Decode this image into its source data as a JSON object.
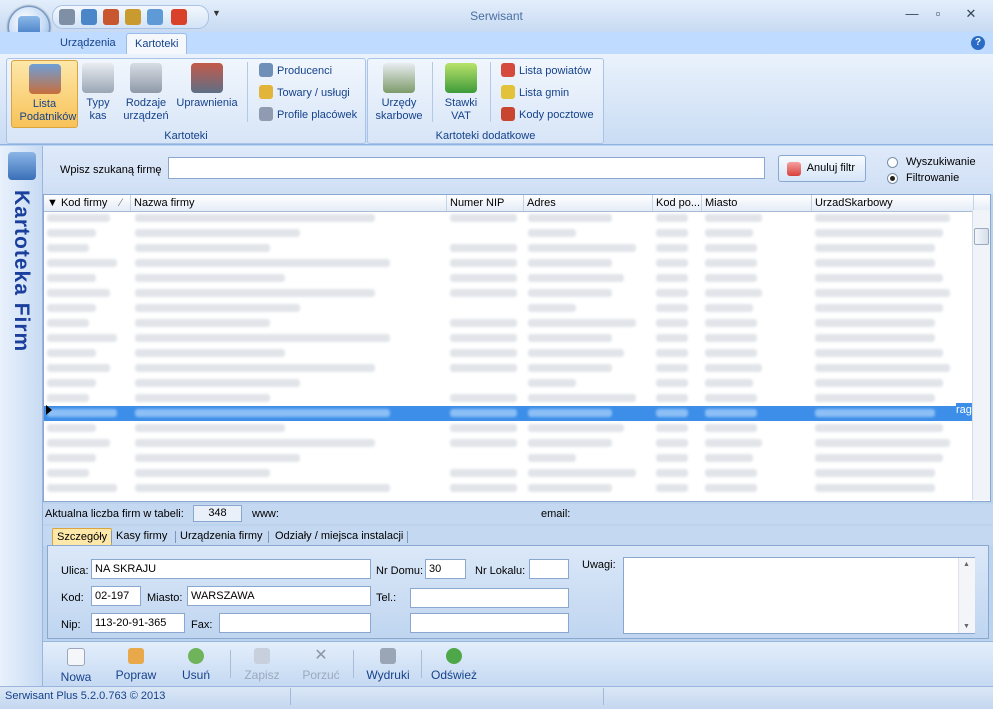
{
  "window": {
    "title": "Serwisant"
  },
  "ribbon": {
    "tabs": [
      "Urządzenia",
      "Kartoteki"
    ],
    "groups": {
      "kartoteki": "Kartoteki",
      "dodatkowe": "Kartoteki dodatkowe"
    },
    "buttons": {
      "lista": "Lista Podatników",
      "typy": "Typy kas",
      "rodzaje": "Rodzaje urządzeń",
      "uprawnienia": "Uprawnienia",
      "producenci": "Producenci",
      "towary": "Towary / usługi",
      "profile": "Profile placówek",
      "urzedy": "Urzędy skarbowe",
      "stawki": "Stawki VAT",
      "powiaty": "Lista powiatów",
      "gminy": "Lista gmin",
      "kody": "Kody pocztowe"
    }
  },
  "sidebar": {
    "title": "Kartoteka Firm"
  },
  "search": {
    "label": "Wpisz szukaną firmę",
    "value": "",
    "cancel_label": "Anuluj filtr",
    "mode_search": "Wyszukiwanie",
    "mode_filter": "Filtrowanie",
    "selected_mode": "Filtrowanie"
  },
  "grid": {
    "columns": [
      "Kod firmy",
      "Nazwa firmy",
      "Numer NIP",
      "Adres",
      "Kod po...",
      "Miasto",
      "UrzadSkarbowy"
    ],
    "selected_overflow": "rag"
  },
  "counts": {
    "label": "Aktualna liczba firm w tabeli:",
    "value": "348",
    "www_label": "www:",
    "email_label": "email:"
  },
  "detail": {
    "tabs": [
      "Szczegóły",
      "Kasy firmy",
      "Urządzenia firmy",
      "Odziały / miejsca instalacji"
    ],
    "labels": {
      "ulica": "Ulica:",
      "kod": "Kod:",
      "miasto": "Miasto:",
      "nip": "Nip:",
      "fax": "Fax:",
      "nr_domu": "Nr Domu:",
      "nr_lokalu": "Nr Lokalu:",
      "tel": "Tel.:",
      "uwagi": "Uwagi:"
    },
    "values": {
      "ulica": "NA SKRAJU",
      "kod": "02-197",
      "miasto": "WARSZAWA",
      "nip": "113-20-91-365",
      "fax": "",
      "nr_domu": "30",
      "nr_lokalu": "",
      "tel": "",
      "extra": ""
    }
  },
  "toolbar": {
    "nowa": "Nowa",
    "popraw": "Popraw",
    "usun": "Usuń",
    "zapisz": "Zapisz",
    "porzuc": "Porzuć",
    "wydruki": "Wydruki",
    "odswiez": "Odśwież"
  },
  "status": {
    "text": "Serwisant Plus 5.2.0.763 © 2013"
  }
}
